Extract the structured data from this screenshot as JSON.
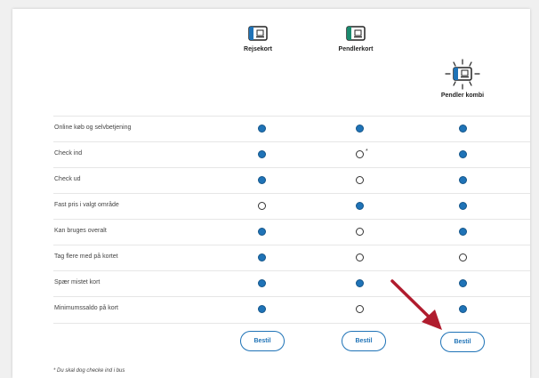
{
  "columns": [
    {
      "title": "Rejsekort",
      "icon": "rejsekort-card-icon",
      "accent": "#1f73b7"
    },
    {
      "title": "Pendlerkort",
      "icon": "pendlerkort-card-icon",
      "accent": "#1a8a6e"
    },
    {
      "title": "Pendler kombi",
      "icon": "pendler-kombi-card-icon",
      "accent": "#1f73b7"
    }
  ],
  "rows": [
    {
      "label": "Online køb og selvbetjening",
      "values": [
        "full",
        "full",
        "full"
      ]
    },
    {
      "label": "Check ind",
      "values": [
        "full",
        "empty",
        "full"
      ],
      "note_mark": "*"
    },
    {
      "label": "Check ud",
      "values": [
        "full",
        "empty",
        "full"
      ]
    },
    {
      "label": "Fast pris i valgt område",
      "values": [
        "empty",
        "full",
        "full"
      ]
    },
    {
      "label": "Kan bruges overalt",
      "values": [
        "full",
        "empty",
        "full"
      ]
    },
    {
      "label": "Tag flere med på kortet",
      "values": [
        "full",
        "empty",
        "empty"
      ]
    },
    {
      "label": "Spær mistet kort",
      "values": [
        "full",
        "full",
        "full"
      ]
    },
    {
      "label": "Minimumssaldo på kort",
      "values": [
        "full",
        "empty",
        "full"
      ]
    }
  ],
  "order_label": "Bestil",
  "footnote": "* Du skal dog checke ind i bus",
  "colors": {
    "filled_dot": "#1f73b7",
    "arrow": "#b01c2e"
  }
}
